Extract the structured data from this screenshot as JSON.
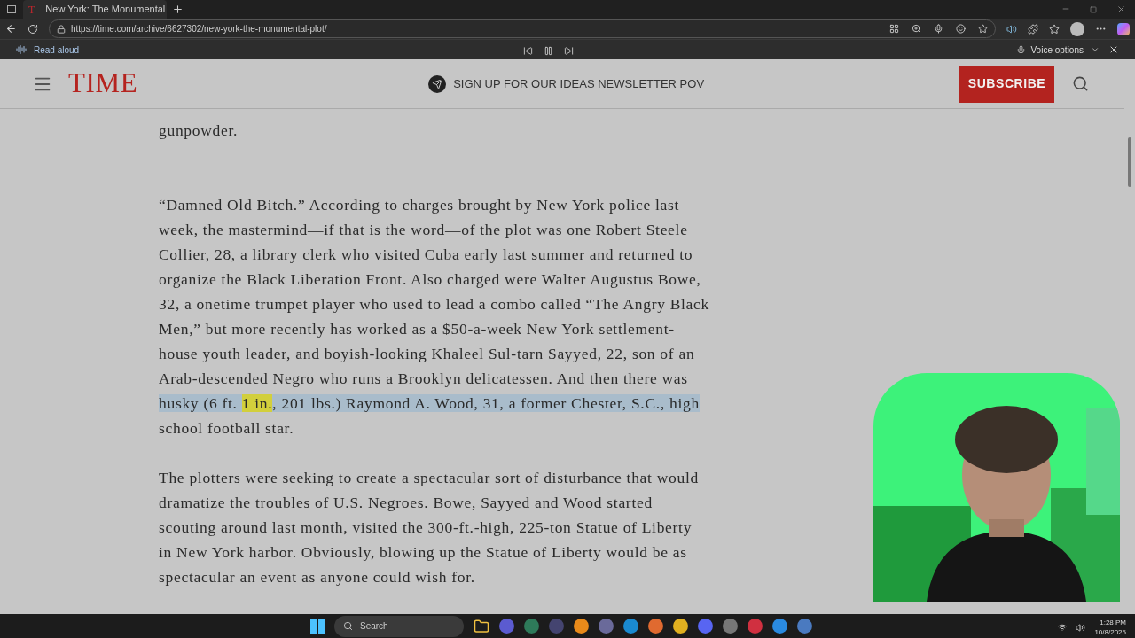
{
  "browser": {
    "tab": {
      "title": "New York: The Monumental",
      "favicon": "T",
      "selected": true
    },
    "url": "https://time.com/archive/6627302/new-york-the-monumental-plot/"
  },
  "read_aloud": {
    "label": "Read aloud",
    "voice_options": "Voice options"
  },
  "header": {
    "logo": "TIME",
    "newsletter": "SIGN UP FOR OUR IDEAS NEWSLETTER POV",
    "subscribe": "SUBSCRIBE"
  },
  "article": [
    {
      "lines": [
        [
          {
            "text": "gunpowder.",
            "highlighted": false,
            "current": false
          }
        ]
      ]
    },
    {
      "lines": [
        [
          {
            "text": "“Damned Old Bitch.” According to charges brought by New York police last",
            "highlighted": false,
            "current": false
          }
        ],
        [
          {
            "text": "week, the mastermind—if that is the word—of the plot was one Robert Steele",
            "highlighted": false,
            "current": false
          }
        ],
        [
          {
            "text": "Collier, 28, a library clerk who visited Cuba early last summer and returned to",
            "highlighted": false,
            "current": false
          }
        ],
        [
          {
            "text": "organize the Black Liberation Front. Also charged were Walter Augustus Bowe,",
            "highlighted": false,
            "current": false
          }
        ],
        [
          {
            "text": "32, a onetime trumpet player who used to lead a combo called “The Angry Black",
            "highlighted": false,
            "current": false
          }
        ],
        [
          {
            "text": "Men,” but more recently has worked as a $50-a-week New York settlement-",
            "highlighted": false,
            "current": false
          }
        ],
        [
          {
            "text": "house youth leader, and boyish-looking Khaleel Sul-tarn Sayyed, 22, son of an",
            "highlighted": false,
            "current": false
          }
        ],
        [
          {
            "text": "Arab-descended Negro who runs a Brooklyn delicatessen. And then there was",
            "highlighted": false,
            "current": false
          }
        ],
        [
          {
            "text": "husky (6 ft. ",
            "highlighted": true,
            "current": false
          },
          {
            "text": "1 in.",
            "highlighted": true,
            "current": true
          },
          {
            "text": ", 201 lbs.) Raymond A. Wood, 31, a former Chester, S.C., high",
            "highlighted": true,
            "current": false
          }
        ],
        [
          {
            "text": "school football star.",
            "highlighted": false,
            "current": false
          }
        ]
      ]
    },
    {
      "lines": [
        [
          {
            "text": "The plotters were seeking to create a spectacular sort of disturbance that would",
            "highlighted": false,
            "current": false
          }
        ],
        [
          {
            "text": "dramatize the troubles of U.S. Negroes. Bowe, Sayyed and Wood started",
            "highlighted": false,
            "current": false
          }
        ],
        [
          {
            "text": "scouting around last month, visited the 300-ft.-high, 225-ton Statue of Liberty",
            "highlighted": false,
            "current": false
          }
        ],
        [
          {
            "text": "in New York harbor. Obviously, blowing up the Statue of Liberty would be as",
            "highlighted": false,
            "current": false
          }
        ],
        [
          {
            "text": "spectacular an event as anyone could wish for.",
            "highlighted": false,
            "current": false
          }
        ]
      ]
    }
  ],
  "taskbar": {
    "search": "Search",
    "time": "1:28 PM",
    "date": "10/8/2025"
  }
}
